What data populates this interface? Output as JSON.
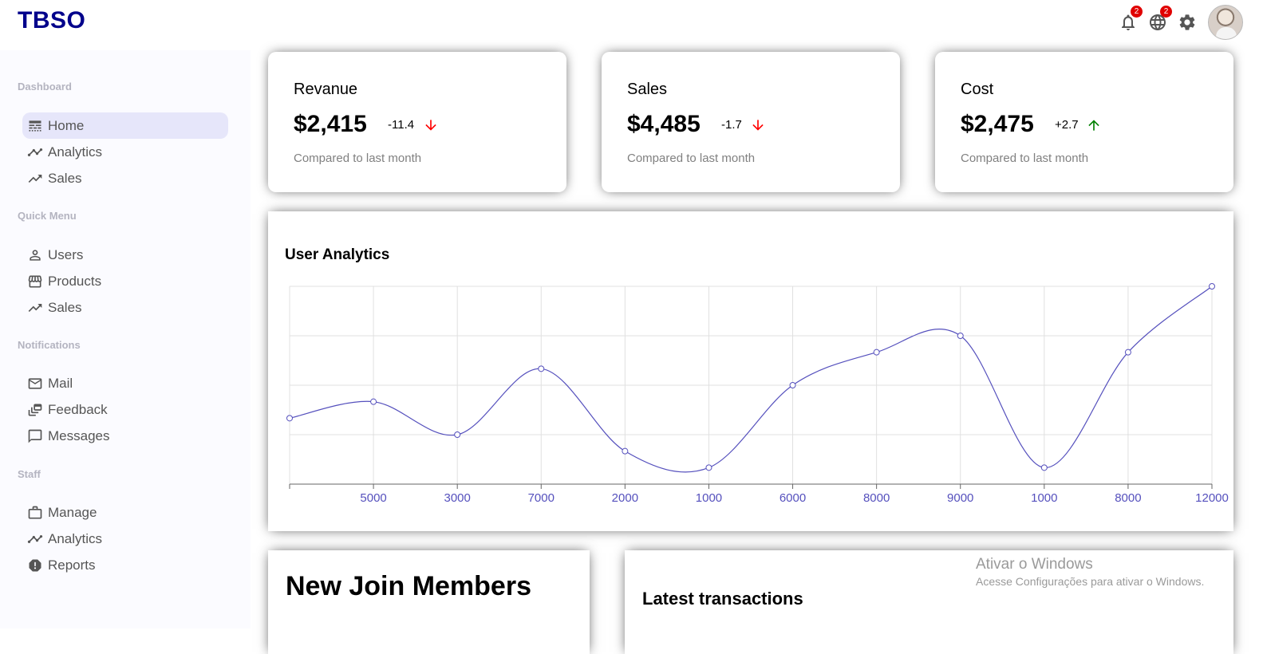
{
  "app": {
    "logo": "TBSO"
  },
  "topbar": {
    "notifications_badge": "2",
    "language_badge": "2",
    "icons": [
      "bell-icon",
      "globe-icon",
      "gear-icon",
      "avatar"
    ]
  },
  "sidebar": {
    "sections": [
      {
        "title": "Dashboard",
        "items": [
          {
            "label": "Home",
            "icon": "line-style-icon",
            "active": true
          },
          {
            "label": "Analytics",
            "icon": "timeline-icon"
          },
          {
            "label": "Sales",
            "icon": "trending-up-icon"
          }
        ]
      },
      {
        "title": "Quick Menu",
        "items": [
          {
            "label": "Users",
            "icon": "person-outline-icon"
          },
          {
            "label": "Products",
            "icon": "storefront-icon"
          },
          {
            "label": "Sales",
            "icon": "trending-up-icon"
          }
        ]
      },
      {
        "title": "Notifications",
        "items": [
          {
            "label": "Mail",
            "icon": "mail-outline-icon"
          },
          {
            "label": "Feedback",
            "icon": "dynamic-feed-icon"
          },
          {
            "label": "Messages",
            "icon": "chat-bubble-outline-icon"
          }
        ]
      },
      {
        "title": "Staff",
        "items": [
          {
            "label": "Manage",
            "icon": "work-outline-icon"
          },
          {
            "label": "Analytics",
            "icon": "timeline-icon"
          },
          {
            "label": "Reports",
            "icon": "report-icon"
          }
        ]
      }
    ]
  },
  "featured": [
    {
      "title": "Revanue",
      "money": "$2,415",
      "rate": "-11.4",
      "trend": "down",
      "sub": "Compared to last month"
    },
    {
      "title": "Sales",
      "money": "$4,485",
      "rate": "-1.7",
      "trend": "down",
      "sub": "Compared to last month"
    },
    {
      "title": "Cost",
      "money": "$2,475",
      "rate": "+2.7",
      "trend": "up",
      "sub": "Compared to last month"
    }
  ],
  "colors": {
    "down": "#ff0000",
    "up": "#008000",
    "line": "#5550bd",
    "logo": "#00008b",
    "active_bg": "#e6e6fa"
  },
  "chart_data": {
    "type": "line",
    "title": "User Analytics",
    "categories": [
      "",
      "5000",
      "3000",
      "7000",
      "2000",
      "1000",
      "6000",
      "8000",
      "9000",
      "1000",
      "8000",
      "12000"
    ],
    "values": [
      4,
      5,
      3,
      7,
      2,
      1,
      6,
      8,
      9,
      1,
      8,
      12
    ],
    "ylim": [
      0,
      12
    ],
    "grid": true,
    "xlabel": "",
    "ylabel": ""
  },
  "widgets": {
    "members_title": "New Join Members",
    "transactions_title": "Latest transactions"
  },
  "watermark": {
    "line1": "Ativar o Windows",
    "line2": "Acesse Configurações para ativar o Windows."
  }
}
